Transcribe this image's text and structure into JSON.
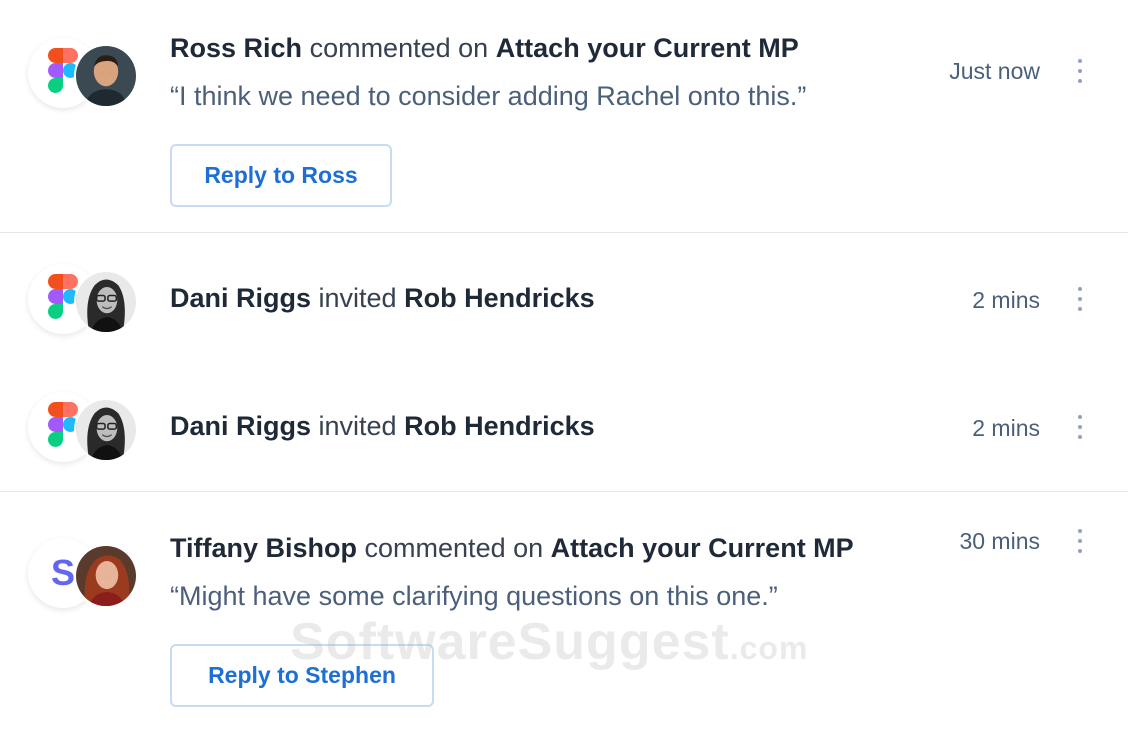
{
  "items": [
    {
      "actor": "Ross Rich",
      "verb": "commented on",
      "target": "Attach your Current MP",
      "quote": "“I think we need to consider adding Rachel onto this.”",
      "time": "Just now",
      "reply_label": "Reply to Ross",
      "app_icon": "figma-icon"
    },
    {
      "actor": "Dani Riggs",
      "verb": "invited",
      "target": "Rob Hendricks",
      "time": "2 mins",
      "app_icon": "figma-icon"
    },
    {
      "actor": "Dani Riggs",
      "verb": "invited",
      "target": "Rob Hendricks",
      "time": "2 mins",
      "app_icon": "figma-icon"
    },
    {
      "actor": "Tiffany Bishop",
      "verb": "commented on",
      "target": "Attach your Current MP",
      "quote": "“Might have some clarifying questions on this one.”",
      "time": "30 mins",
      "reply_label": "Reply to Stephen",
      "app_icon": "s-logo-icon",
      "app_letter": "S"
    }
  ],
  "watermark": {
    "brand": "SoftwareSuggest",
    "suffix": ".com"
  },
  "colors": {
    "accent": "#1d6fd6",
    "muted_text": "#4b5f7b",
    "divider": "#e5e7eb",
    "s_logo": "#6366f1"
  }
}
